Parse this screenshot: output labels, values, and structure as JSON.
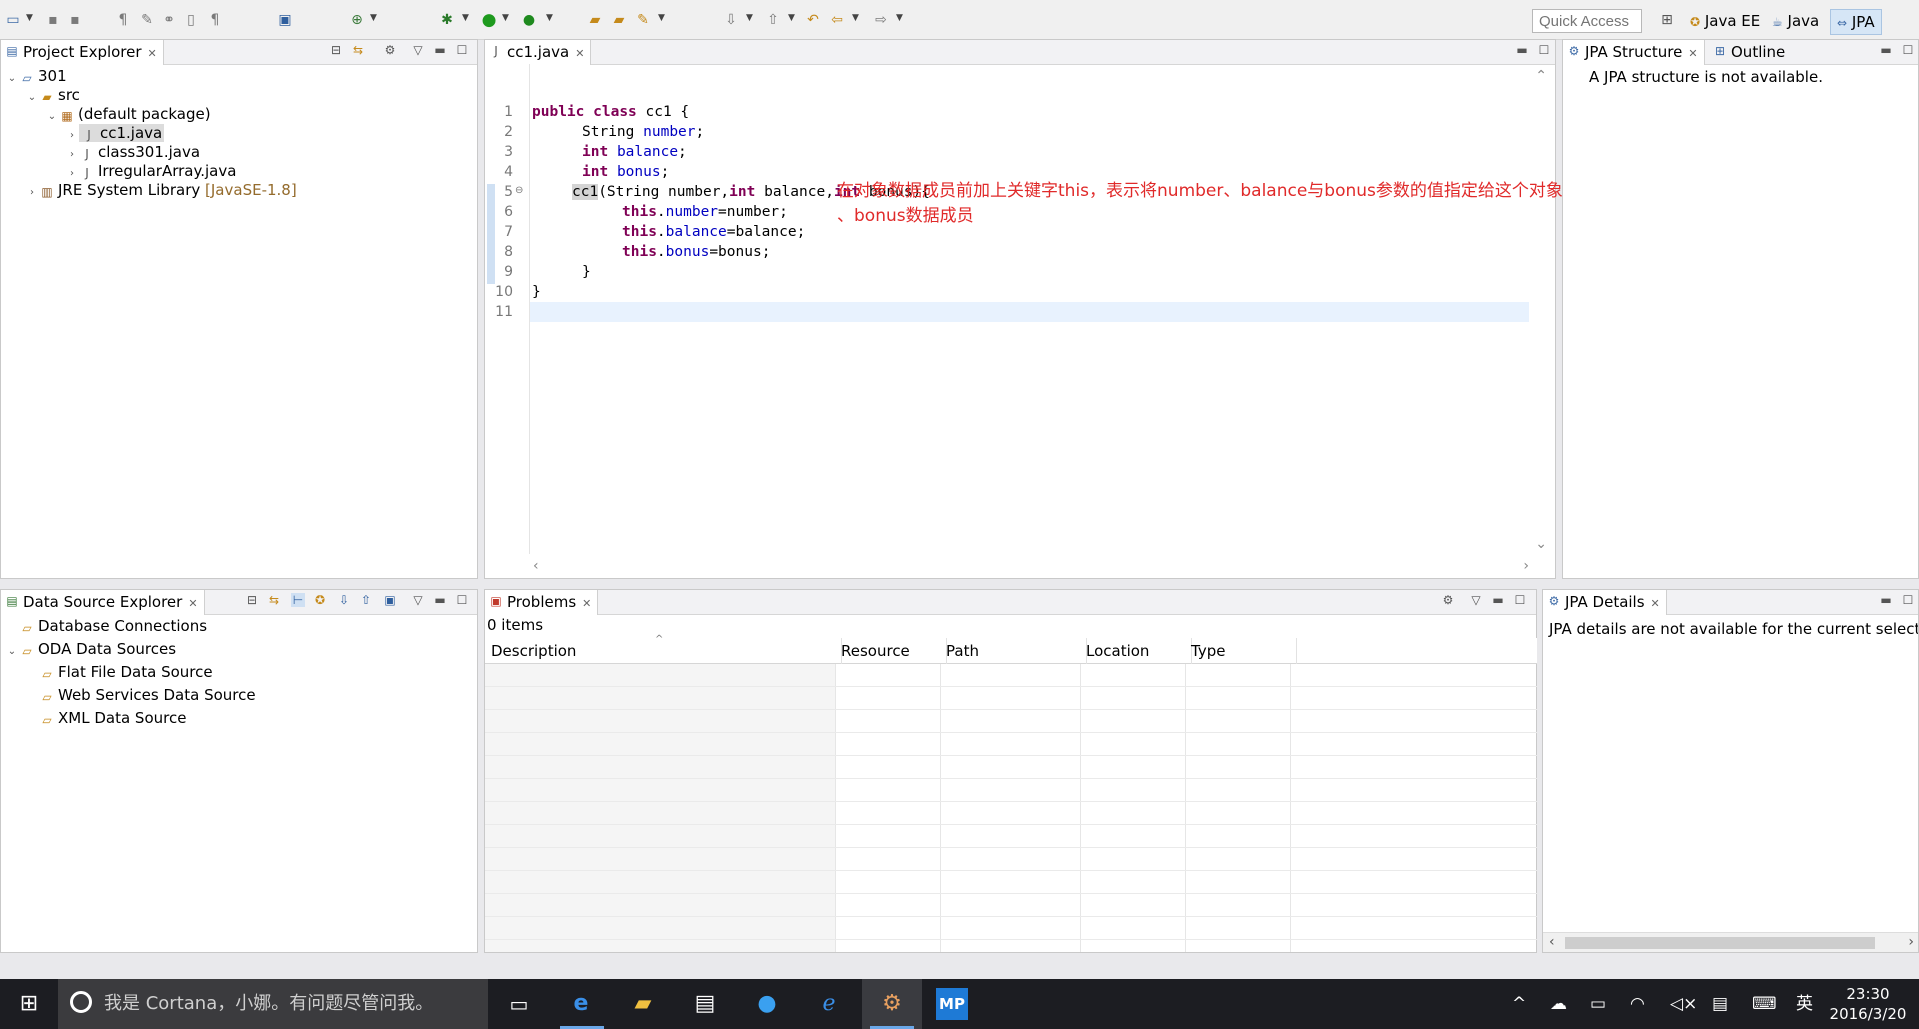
{
  "toolbar": {
    "quick_access_placeholder": "Quick Access"
  },
  "perspectives": [
    {
      "label": "Java EE",
      "icon": "java-ee-icon"
    },
    {
      "label": "Java",
      "icon": "java-icon"
    },
    {
      "label": "JPA",
      "icon": "jpa-icon",
      "selected": true
    }
  ],
  "project_explorer": {
    "tab": "Project Explorer",
    "tree": [
      {
        "label": "301"
      },
      {
        "label": "src"
      },
      {
        "label": "(default package)"
      },
      {
        "label": "cc1.java",
        "selected": true
      },
      {
        "label": "class301.java"
      },
      {
        "label": "IrregularArray.java"
      },
      {
        "label": "JRE System Library",
        "suffix": "[JavaSE-1.8]"
      }
    ]
  },
  "editor": {
    "tab": "cc1.java",
    "lines": [
      "1",
      "2",
      "3",
      "4",
      "5",
      "6",
      "7",
      "8",
      "9",
      "10",
      "11"
    ],
    "code": {
      "l1_kw1": "public",
      "l1_kw2": "class",
      "l1_rest": "cc1 {",
      "l2_type": "String",
      "l2_field": "number",
      "l2_end": ";",
      "l3_kw": "int",
      "l3_field": "balance",
      "l3_end": ";",
      "l4_kw": "int",
      "l4_field": "bonus",
      "l4_end": ";",
      "l5_name": "cc1",
      "l5_a": "(String number,",
      "l5_kw1": "int",
      "l5_b": " balance,",
      "l5_kw2": "int",
      "l5_c": " bonus){",
      "l6_kw": "this",
      "l6_field": "number",
      "l6_rest": "=number;",
      "l7_kw": "this",
      "l7_field": "balance",
      "l7_rest": "=balance;",
      "l8_kw": "this",
      "l8_field": "bonus",
      "l8_rest": "=bonus;",
      "l9": "}",
      "l10": "}"
    },
    "annotation_line1": "在对象数据成员前加上关键字this，表示将number、balance与bonus参数的值指定给这个对象（this）的number、balance",
    "annotation_line2": "、bonus数据成员"
  },
  "jpa_structure": {
    "tab": "JPA Structure",
    "tab2": "Outline",
    "message": "A JPA structure is not available."
  },
  "data_source_explorer": {
    "tab": "Data Source Explorer",
    "tree": [
      {
        "label": "Database Connections"
      },
      {
        "label": "ODA Data Sources"
      },
      {
        "label": "Flat File Data Source"
      },
      {
        "label": "Web Services Data Source"
      },
      {
        "label": "XML Data Source"
      }
    ]
  },
  "problems": {
    "tab": "Problems",
    "count": "0 items",
    "columns": [
      "Description",
      "Resource",
      "Path",
      "Location",
      "Type"
    ]
  },
  "jpa_details": {
    "tab": "JPA Details",
    "message": "JPA details are not available for the current selectic"
  },
  "taskbar": {
    "search_text": "我是 Cortana，小娜。有问题尽管问我。",
    "ime": "英",
    "time": "23:30",
    "date": "2016/3/20"
  }
}
